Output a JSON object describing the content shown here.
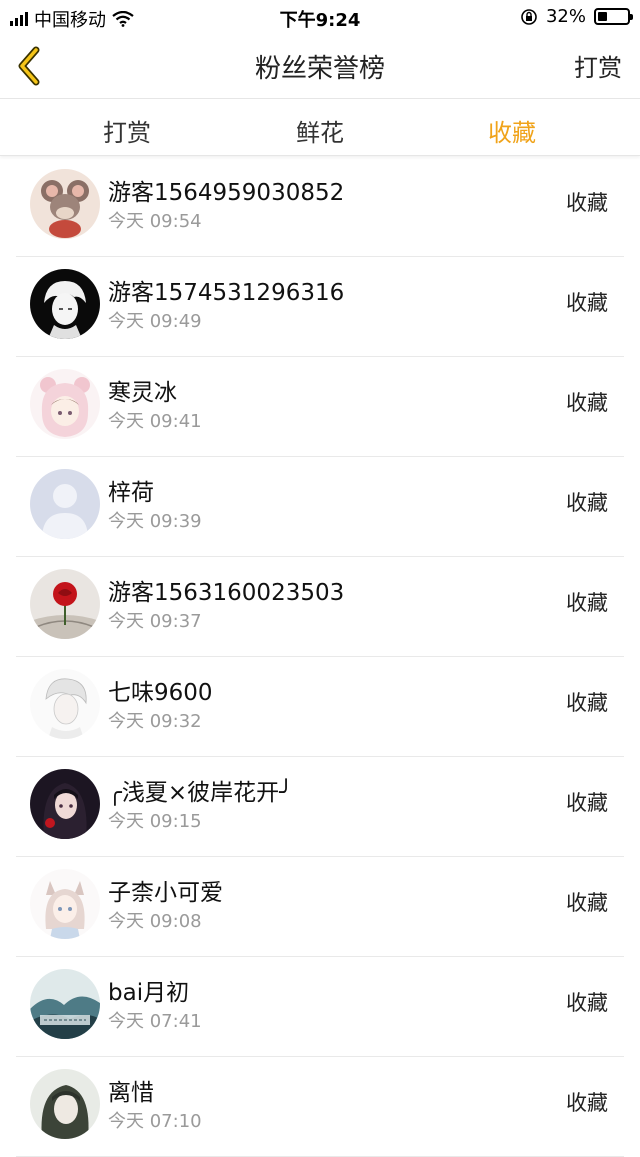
{
  "status_bar": {
    "carrier": "中国移动",
    "time": "下午9:24",
    "battery": "32%",
    "battery_level": 0.32
  },
  "nav": {
    "title": "粉丝荣誉榜",
    "right_action": "打赏"
  },
  "tabs": [
    {
      "label": "打赏",
      "active": false
    },
    {
      "label": "鲜花",
      "active": false
    },
    {
      "label": "收藏",
      "active": true
    }
  ],
  "accent_color": "#f0a31a",
  "list": [
    {
      "name": "游客1564959030852",
      "time": "今天 09:54",
      "action": "收藏",
      "avatar": "cartoon-mouse-avatar"
    },
    {
      "name": "游客1574531296316",
      "time": "今天 09:49",
      "action": "收藏",
      "avatar": "anime-boy-avatar"
    },
    {
      "name": "寒灵冰",
      "time": "今天 09:41",
      "action": "收藏",
      "avatar": "anime-girl-pink-hood-avatar"
    },
    {
      "name": "梓荷",
      "time": "今天 09:39",
      "action": "收藏",
      "avatar": "default-user-avatar"
    },
    {
      "name": "游客1563160023503",
      "time": "今天 09:37",
      "action": "收藏",
      "avatar": "red-rose-avatar"
    },
    {
      "name": "七味9600",
      "time": "今天 09:32",
      "action": "收藏",
      "avatar": "anime-sketch-avatar"
    },
    {
      "name": "╭浅夏×彼岸花开╯",
      "time": "今天 09:15",
      "action": "收藏",
      "avatar": "anime-girl-dark-avatar"
    },
    {
      "name": "子柰小可爱",
      "time": "今天 09:08",
      "action": "收藏",
      "avatar": "anime-cat-girl-avatar"
    },
    {
      "name": "bai月初",
      "time": "今天 07:41",
      "action": "收藏",
      "avatar": "ink-landscape-avatar"
    },
    {
      "name": "离惜",
      "time": "今天 07:10",
      "action": "收藏",
      "avatar": "ink-portrait-avatar"
    }
  ]
}
